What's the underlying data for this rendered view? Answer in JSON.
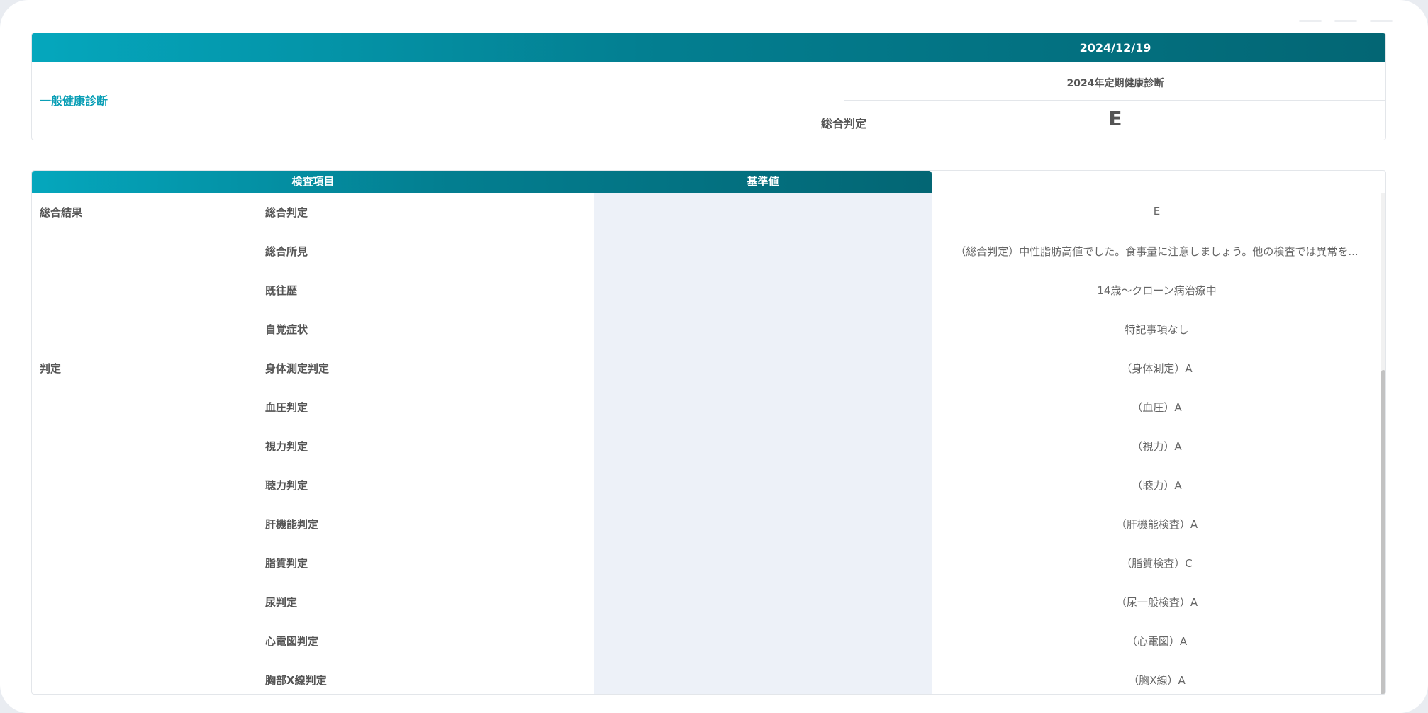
{
  "summary": {
    "date": "2024/12/19",
    "category": "一般健康診断",
    "exam_name": "2024年定期健康診断",
    "judge_label": "総合判定",
    "judge_value": "E"
  },
  "table": {
    "headers": {
      "item": "検査項目",
      "reference": "基準値"
    },
    "groups": [
      {
        "category": "総合結果",
        "rows": [
          {
            "item": "総合判定",
            "value": "E"
          },
          {
            "item": "総合所見",
            "value": "（総合判定）中性脂肪高値でした。食事量に注意しましょう。他の検査では異常を..."
          },
          {
            "item": "既往歴",
            "value": "14歳～クローン病治療中"
          },
          {
            "item": "自覚症状",
            "value": "特記事項なし"
          }
        ]
      },
      {
        "category": "判定",
        "rows": [
          {
            "item": "身体測定判定",
            "value": "（身体測定）A"
          },
          {
            "item": "血圧判定",
            "value": "（血圧）A"
          },
          {
            "item": "視力判定",
            "value": "（視力）A"
          },
          {
            "item": "聴力判定",
            "value": "（聴力）A"
          },
          {
            "item": "肝機能判定",
            "value": "（肝機能検査）A"
          },
          {
            "item": "脂質判定",
            "value": "（脂質検査）C"
          },
          {
            "item": "尿判定",
            "value": "（尿一般検査）A"
          },
          {
            "item": "心電図判定",
            "value": "（心電図）A"
          },
          {
            "item": "胸部X線判定",
            "value": "（胸X線）A"
          }
        ]
      }
    ]
  },
  "colors": {
    "header_gradient_start": "#05a7bd",
    "header_gradient_end": "#036674",
    "category_accent": "#0b9fb6",
    "reference_column_bg": "#edf1f8"
  }
}
